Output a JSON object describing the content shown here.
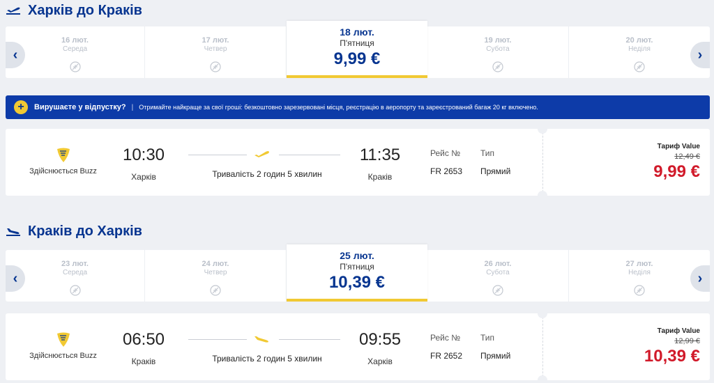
{
  "outbound": {
    "title": "Харків до Краків",
    "dates": [
      {
        "date": "16 лют.",
        "weekday": "Середа"
      },
      {
        "date": "17 лют.",
        "weekday": "Четвер"
      },
      {
        "date": "19 лют.",
        "weekday": "Субота"
      },
      {
        "date": "20 лют.",
        "weekday": "Неділя"
      }
    ],
    "selected": {
      "date": "18 лют.",
      "weekday": "П'ятниця",
      "price": "9,99 €"
    },
    "flight": {
      "operator": "Здійснюється Buzz",
      "dep_time": "10:30",
      "dep_city": "Харків",
      "arr_time": "11:35",
      "arr_city": "Краків",
      "duration": "Тривалість 2 годин 5 хвилин",
      "flight_label": "Рейс №",
      "flight_no": "FR 2653",
      "type_label": "Тип",
      "type_value": "Прямий",
      "fare_label": "Тариф Value",
      "old_price": "12,49 €",
      "price": "9,99 €"
    }
  },
  "promo": {
    "headline": "Вирушаєте у відпустку?",
    "separator": "|",
    "text": "Отримайте найкраще за свої гроші: безкоштовно зарезервовані місця, реєстрацію в аеропорту та зареєстрований багаж 20 кг включено."
  },
  "inbound": {
    "title": "Краків до Харків",
    "dates": [
      {
        "date": "23 лют.",
        "weekday": "Середа"
      },
      {
        "date": "24 лют.",
        "weekday": "Четвер"
      },
      {
        "date": "26 лют.",
        "weekday": "Субота"
      },
      {
        "date": "27 лют.",
        "weekday": "Неділя"
      }
    ],
    "selected": {
      "date": "25 лют.",
      "weekday": "П'ятниця",
      "price": "10,39 €"
    },
    "flight": {
      "operator": "Здійснюється Buzz",
      "dep_time": "06:50",
      "dep_city": "Краків",
      "arr_time": "09:55",
      "arr_city": "Харків",
      "duration": "Тривалість 2 годин 5 хвилин",
      "flight_label": "Рейс №",
      "flight_no": "FR 2652",
      "type_label": "Тип",
      "type_value": "Прямий",
      "fare_label": "Тариф Value",
      "old_price": "12,99 €",
      "price": "10,39 €"
    }
  },
  "icons": {
    "nav_prev": "chevron-left-icon",
    "nav_next": "chevron-right-icon",
    "no_flight": "no-flight-icon",
    "takeoff": "takeoff-plane-icon",
    "landing": "landing-plane-icon",
    "logo": "ryanair-harp-logo",
    "promo": "plus-circle-icon"
  },
  "colors": {
    "brand": "#073590",
    "accent": "#f1c933",
    "price": "#d11a2a",
    "promo_bg": "#0d3ba8"
  }
}
